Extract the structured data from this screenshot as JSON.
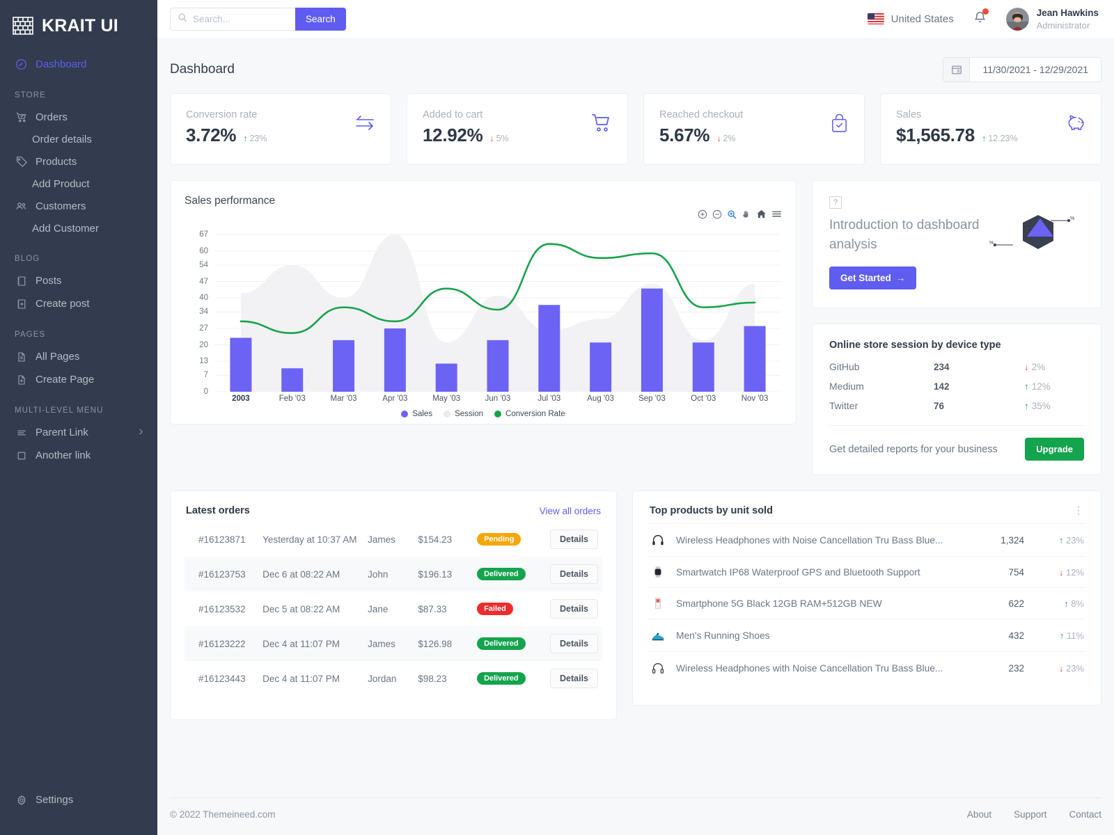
{
  "brand": {
    "name": "KRAIT UI",
    "logo_icon": "brick-wall-icon"
  },
  "sidebar": {
    "primary": [
      {
        "label": "Dashboard",
        "icon": "gauge-icon",
        "active": true
      }
    ],
    "sections": [
      {
        "title": "STORE",
        "items": [
          {
            "label": "Orders",
            "icon": "cart-check-icon",
            "sub": false
          },
          {
            "label": "Order details",
            "icon": "",
            "sub": true
          },
          {
            "label": "Products",
            "icon": "tag-icon",
            "sub": false
          },
          {
            "label": "Add Product",
            "icon": "",
            "sub": true
          },
          {
            "label": "Customers",
            "icon": "users-icon",
            "sub": false
          },
          {
            "label": "Add Customer",
            "icon": "",
            "sub": true
          }
        ]
      },
      {
        "title": "BLOG",
        "items": [
          {
            "label": "Posts",
            "icon": "notebook-icon",
            "sub": false
          },
          {
            "label": "Create post",
            "icon": "notebook-plus-icon",
            "sub": false
          }
        ]
      },
      {
        "title": "PAGES",
        "items": [
          {
            "label": "All Pages",
            "icon": "document-icon",
            "sub": false
          },
          {
            "label": "Create Page",
            "icon": "document-plus-icon",
            "sub": false
          }
        ]
      },
      {
        "title": "MULTI-LEVEL MENU",
        "items": [
          {
            "label": "Parent Link",
            "icon": "menu-lines-icon",
            "sub": false,
            "chevron": true
          },
          {
            "label": "Another link",
            "icon": "square-icon",
            "sub": false
          }
        ]
      }
    ],
    "footer": {
      "label": "Settings",
      "icon": "gear-icon"
    }
  },
  "topbar": {
    "search": {
      "placeholder": "Search...",
      "value": "",
      "button_label": "Search"
    },
    "country": "United States",
    "notification_icon": "bell-icon",
    "user": {
      "name": "Jean Hawkins",
      "role": "Administrator"
    }
  },
  "page": {
    "title": "Dashboard",
    "date_range": "11/30/2021 - 12/29/2021"
  },
  "stats": [
    {
      "label": "Conversion rate",
      "value": "3.72%",
      "delta": "23%",
      "dir": "up",
      "icon": "transfer-arrows-icon"
    },
    {
      "label": "Added to cart",
      "value": "12.92%",
      "delta": "5%",
      "dir": "down",
      "icon": "shopping-cart-icon"
    },
    {
      "label": "Reached checkout",
      "value": "5.67%",
      "delta": "2%",
      "dir": "down",
      "icon": "bag-check-icon"
    },
    {
      "label": "Sales",
      "value": "$1,565.78",
      "delta": "12.23%",
      "dir": "up",
      "icon": "piggy-bank-icon"
    }
  ],
  "chart_data": {
    "type": "bar",
    "title": "Sales performance",
    "xlabel": "",
    "ylabel": "",
    "ylim": [
      0,
      70
    ],
    "yticks": [
      0,
      7,
      13,
      20,
      27,
      34,
      40,
      47,
      54,
      60,
      67
    ],
    "grid": true,
    "legend_position": "bottom",
    "categories": [
      "2003",
      "Feb '03",
      "Mar '03",
      "Apr '03",
      "May '03",
      "Jun '03",
      "Jul '03",
      "Aug '03",
      "Sep '03",
      "Oct '03",
      "Nov '03"
    ],
    "series": [
      {
        "name": "Sales",
        "type": "bar",
        "color": "#6c63f5",
        "values": [
          23,
          10,
          22,
          27,
          12,
          22,
          37,
          21,
          44,
          21,
          28
        ]
      },
      {
        "name": "Session",
        "type": "area",
        "color": "#f1f1f3",
        "values": [
          42,
          54,
          40,
          67,
          21,
          41,
          26,
          31,
          46,
          22,
          46
        ]
      },
      {
        "name": "Conversion Rate",
        "type": "line",
        "color": "#16a34a",
        "values": [
          30,
          25,
          36,
          30,
          44,
          35,
          63,
          57,
          59,
          36,
          38
        ]
      }
    ],
    "toolbar_icons": [
      "zoom-in-icon",
      "zoom-out-icon",
      "selection-zoom-icon",
      "pan-icon",
      "home-reset-icon",
      "menu-icon"
    ]
  },
  "intro_card": {
    "badge": "?",
    "title": "Introduction to dashboard analysis",
    "button_label": "Get Started",
    "button_arrow": "→",
    "art_icon": "hexagon-triangle-illustration"
  },
  "device_card": {
    "title": "Online store session by device type",
    "rows": [
      {
        "name": "GitHub",
        "count": "234",
        "delta": "2%",
        "dir": "down"
      },
      {
        "name": "Medium",
        "count": "142",
        "delta": "12%",
        "dir": "up"
      },
      {
        "name": "Twitter",
        "count": "76",
        "delta": "35%",
        "dir": "up"
      }
    ],
    "footer_text": "Get detailed reports for your business",
    "upgrade_label": "Upgrade"
  },
  "orders_card": {
    "title": "Latest orders",
    "view_all": "View all orders",
    "details_label": "Details",
    "rows": [
      {
        "id": "#16123871",
        "date": "Yesterday at 10:37 AM",
        "customer": "James",
        "amount": "$154.23",
        "status": "Pending",
        "status_kind": "pending"
      },
      {
        "id": "#16123753",
        "date": "Dec 6 at 08:22 AM",
        "customer": "John",
        "amount": "$196.13",
        "status": "Delivered",
        "status_kind": "delivered"
      },
      {
        "id": "#16123532",
        "date": "Dec 5 at 08:22 AM",
        "customer": "Jane",
        "amount": "$87.33",
        "status": "Failed",
        "status_kind": "failed"
      },
      {
        "id": "#16123222",
        "date": "Dec 4 at 11:07 PM",
        "customer": "James",
        "amount": "$126.98",
        "status": "Delivered",
        "status_kind": "delivered"
      },
      {
        "id": "#16123443",
        "date": "Dec 4 at 11:07 PM",
        "customer": "Jordan",
        "amount": "$98.23",
        "status": "Delivered",
        "status_kind": "delivered"
      }
    ]
  },
  "products_card": {
    "title": "Top products by unit sold",
    "menu_icon": "kebab-menu-icon",
    "rows": [
      {
        "name": "Wireless Headphones with Noise Cancellation Tru Bass Blue...",
        "icon": "headphones-icon",
        "units": "1,324",
        "delta": "23%",
        "dir": "up"
      },
      {
        "name": "Smartwatch IP68 Waterproof GPS and Bluetooth Support",
        "icon": "smartwatch-icon",
        "units": "754",
        "delta": "12%",
        "dir": "down"
      },
      {
        "name": "Smartphone 5G Black 12GB RAM+512GB NEW",
        "icon": "smartphone-icon",
        "units": "622",
        "delta": "8%",
        "dir": "up"
      },
      {
        "name": "Men's Running Shoes",
        "icon": "shoe-icon",
        "units": "432",
        "delta": "11%",
        "dir": "up"
      },
      {
        "name": "Wireless Headphones with Noise Cancellation Tru Bass Blue...",
        "icon": "headphones-icon",
        "units": "232",
        "delta": "23%",
        "dir": "down"
      }
    ]
  },
  "footer": {
    "copyright": "© 2022 Themeineed.com",
    "links": [
      "About",
      "Support",
      "Contact"
    ]
  },
  "colors": {
    "accent": "#5f5cf0",
    "bar": "#6c63f5",
    "line": "#16a34a",
    "area": "#f1f1f3",
    "up": "#21a25a",
    "down": "#ef4b3a",
    "sidebar": "#333c4e"
  }
}
